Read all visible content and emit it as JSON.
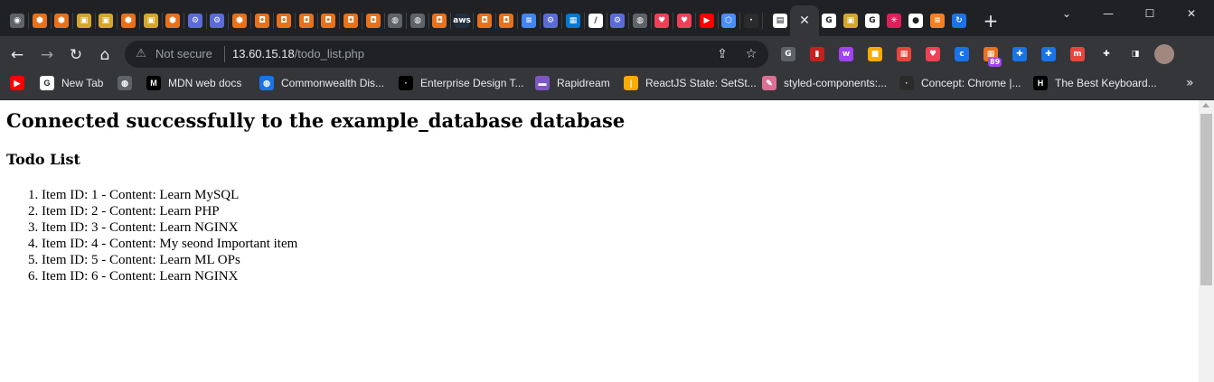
{
  "browser": {
    "active_tab_close": "✕",
    "new_tab": "+",
    "window_controls": {
      "minimize": "—",
      "maximize": "☐",
      "close": "✕",
      "tab_search": "⌄"
    },
    "tab_favicons": [
      {
        "icon": "chrome-icon",
        "color": "#5f6368",
        "glyph": "◉"
      },
      {
        "icon": "aws-orange-icon",
        "color": "#e8711a",
        "glyph": "⬢"
      },
      {
        "icon": "aws-orange-icon",
        "color": "#e8711a",
        "glyph": "⬢"
      },
      {
        "icon": "cube-icon",
        "color": "#d4a72c",
        "glyph": "▣"
      },
      {
        "icon": "cube-icon",
        "color": "#d4a72c",
        "glyph": "▣"
      },
      {
        "icon": "aws-orange-icon",
        "color": "#e8711a",
        "glyph": "⬢"
      },
      {
        "icon": "cube-icon",
        "color": "#d4a72c",
        "glyph": "▣"
      },
      {
        "icon": "aws-orange-icon",
        "color": "#e8711a",
        "glyph": "⬢"
      },
      {
        "icon": "blue-gear-icon",
        "color": "#5b6cd8",
        "glyph": "⚙"
      },
      {
        "icon": "blue-gear-icon",
        "color": "#5b6cd8",
        "glyph": "⚙"
      },
      {
        "icon": "aws-orange-icon",
        "color": "#e8711a",
        "glyph": "⬢"
      },
      {
        "icon": "aws-square-icon",
        "color": "#e8711a",
        "glyph": "◘"
      },
      {
        "icon": "aws-square-icon",
        "color": "#e8711a",
        "glyph": "◘"
      },
      {
        "icon": "aws-square-icon",
        "color": "#e8711a",
        "glyph": "◘"
      },
      {
        "icon": "aws-square-icon",
        "color": "#e8711a",
        "glyph": "◘"
      },
      {
        "icon": "aws-square-icon",
        "color": "#e8711a",
        "glyph": "◘"
      },
      {
        "icon": "aws-square-icon",
        "color": "#e8711a",
        "glyph": "◘"
      },
      {
        "icon": "globe-icon",
        "color": "#5f6368",
        "glyph": "◍"
      },
      {
        "icon": "globe-icon",
        "color": "#5f6368",
        "glyph": "◍"
      },
      {
        "icon": "aws-square-icon",
        "color": "#e8711a",
        "glyph": "◘"
      },
      {
        "icon": "aws-logo-icon",
        "color": "#232f3e",
        "glyph": "aws"
      },
      {
        "icon": "aws-square-icon",
        "color": "#e8711a",
        "glyph": "◘"
      },
      {
        "icon": "aws-square-icon",
        "color": "#e8711a",
        "glyph": "◘"
      },
      {
        "icon": "docs-icon",
        "color": "#4285f4",
        "glyph": "≡"
      },
      {
        "icon": "blue-gear-icon",
        "color": "#5b6cd8",
        "glyph": "⚙"
      },
      {
        "icon": "microsoft-icon",
        "color": "#0078d4",
        "glyph": "▦"
      },
      {
        "icon": "slash-icon",
        "color": "#ffffff",
        "glyph": "/"
      },
      {
        "icon": "blue-gear-icon",
        "color": "#5b6cd8",
        "glyph": "⚙"
      },
      {
        "icon": "globe-icon",
        "color": "#5f6368",
        "glyph": "◍"
      },
      {
        "icon": "pocket-icon",
        "color": "#ef4056",
        "glyph": "♥"
      },
      {
        "icon": "pocket-icon",
        "color": "#ef4056",
        "glyph": "♥"
      },
      {
        "icon": "youtube-icon",
        "color": "#ff0000",
        "glyph": "▶"
      },
      {
        "icon": "hexagon-outline-icon",
        "color": "#4d8ef7",
        "glyph": "⬡"
      },
      {
        "icon": "dark-logo-icon",
        "color": "#2b2b2b",
        "glyph": "·"
      }
    ],
    "tab_favicons_right": [
      {
        "icon": "google-icon",
        "color": "#ffffff",
        "glyph": "G"
      },
      {
        "icon": "cube-icon",
        "color": "#d4a72c",
        "glyph": "▣"
      },
      {
        "icon": "google-icon",
        "color": "#ffffff",
        "glyph": "G"
      },
      {
        "icon": "slack-icon",
        "color": "#e01e5a",
        "glyph": "✳"
      },
      {
        "icon": "github-icon",
        "color": "#ffffff",
        "glyph": "●"
      },
      {
        "icon": "stackoverflow-icon",
        "color": "#f48024",
        "glyph": "≡"
      },
      {
        "icon": "refresh-blue-icon",
        "color": "#1a73e8",
        "glyph": "↻"
      }
    ],
    "active_tab_favicon": {
      "icon": "active-tab-icon",
      "color": "#ffffff",
      "glyph": "▤"
    },
    "toolbar": {
      "back": "←",
      "forward": "→",
      "reload": "↻",
      "home": "⌂",
      "not_secure_icon": "⚠",
      "not_secure_label": "Not secure",
      "url_host": "13.60.15.18",
      "url_path": "/todo_list.php",
      "share": "⇪",
      "bookmark_star": "☆"
    },
    "extensions": [
      {
        "icon": "grammarly-icon",
        "color": "#5f6368",
        "glyph": "G"
      },
      {
        "icon": "red-book-icon",
        "color": "#c5221f",
        "glyph": "▮"
      },
      {
        "icon": "purple-w-icon",
        "color": "#a142f4",
        "glyph": "w"
      },
      {
        "icon": "yellow-note-icon",
        "color": "#f9ab00",
        "glyph": "■"
      },
      {
        "icon": "calendar-grid-icon",
        "color": "#e8453c",
        "glyph": "▦"
      },
      {
        "icon": "pocket-icon",
        "color": "#ef4056",
        "glyph": "♥"
      },
      {
        "icon": "blue-c-icon",
        "color": "#1a73e8",
        "glyph": "c"
      },
      {
        "icon": "badged-extension-icon",
        "color": "#e8711a",
        "glyph": "▦"
      },
      {
        "icon": "puzzle-blue-icon",
        "color": "#1a73e8",
        "glyph": "✚"
      },
      {
        "icon": "puzzle-blue-icon",
        "color": "#1a73e8",
        "glyph": "✚"
      },
      {
        "icon": "red-m-icon",
        "color": "#e8453c",
        "glyph": "m"
      },
      {
        "icon": "extensions-puzzle-icon",
        "color": "#35363a",
        "glyph": "✚"
      },
      {
        "icon": "side-panel-icon",
        "color": "#35363a",
        "glyph": "◨"
      }
    ],
    "extension_badge": "89",
    "bookmarks": [
      {
        "label": "",
        "icon": "youtube-icon",
        "color": "#ff0000",
        "glyph": "▶"
      },
      {
        "label": "New Tab",
        "icon": "google-icon",
        "color": "#ffffff",
        "glyph": "G"
      },
      {
        "label": "",
        "icon": "globe-icon",
        "color": "#5f6368",
        "glyph": "◍"
      },
      {
        "label": "MDN web docs",
        "icon": "mdn-icon",
        "color": "#000000",
        "glyph": "M"
      },
      {
        "label": "Commonwealth Dis...",
        "icon": "globe-blue-icon",
        "color": "#1a73e8",
        "glyph": "◍"
      },
      {
        "label": "Enterprise Design T...",
        "icon": "ibm-icon",
        "color": "#000000",
        "glyph": "∙"
      },
      {
        "label": "Rapidream",
        "icon": "rapidream-icon",
        "color": "#7e57c2",
        "glyph": "▬"
      },
      {
        "label": "ReactJS State: SetSt...",
        "icon": "bar-icon",
        "color": "#f9ab00",
        "glyph": "|"
      },
      {
        "label": "styled-components:...",
        "icon": "styled-icon",
        "color": "#db7093",
        "glyph": "✎"
      },
      {
        "label": "Concept: Chrome |...",
        "icon": "dark-logo-icon",
        "color": "#2b2b2b",
        "glyph": "·"
      },
      {
        "label": "The Best Keyboard...",
        "icon": "htg-icon",
        "color": "#000000",
        "glyph": "H"
      }
    ],
    "bookmarks_overflow": "»"
  },
  "page": {
    "heading": "Connected successfully to the example_database database",
    "subheading": "Todo List",
    "items": [
      "Item ID: 1 - Content: Learn MySQL",
      "Item ID: 2 - Content: Learn PHP",
      "Item ID: 3 - Content: Learn NGINX",
      "Item ID: 4 - Content: My seond Important item",
      "Item ID: 5 - Content: Learn ML OPs",
      "Item ID: 6 - Content: Learn NGINX"
    ]
  }
}
